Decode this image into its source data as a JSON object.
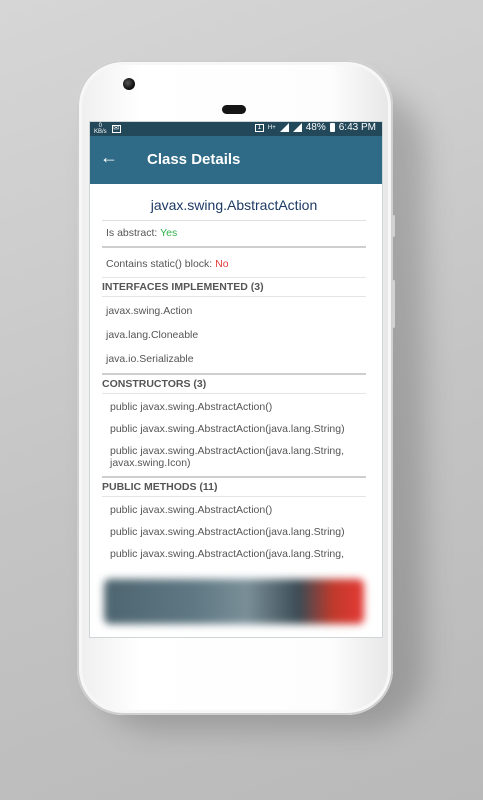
{
  "status_bar": {
    "left_top": "0",
    "left_bottom": "KB/s",
    "sim_badge": "1",
    "net_type": "H+",
    "battery": "48%",
    "time": "6:43 PM"
  },
  "app_bar": {
    "back_glyph": "←",
    "title": "Class Details"
  },
  "class_name": "javax.swing.AbstractAction",
  "props": {
    "is_abstract_label": "Is abstract: ",
    "is_abstract_value": "Yes",
    "static_block_label": "Contains static() block: ",
    "static_block_value": "No"
  },
  "interfaces": {
    "header": "INTERFACES IMPLEMENTED (3)",
    "items": [
      "javax.swing.Action",
      "java.lang.Cloneable",
      "java.io.Serializable"
    ]
  },
  "constructors": {
    "header": "CONSTRUCTORS (3)",
    "items": [
      "public javax.swing.AbstractAction()",
      "public javax.swing.AbstractAction(java.lang.String)",
      "public javax.swing.AbstractAction(java.lang.String, javax.swing.Icon)"
    ]
  },
  "methods": {
    "header": "PUBLIC METHODS (11)",
    "items": [
      "public javax.swing.AbstractAction()",
      "public javax.swing.AbstractAction(java.lang.String)",
      "public javax.swing.AbstractAction(java.lang.String,"
    ]
  },
  "colors": {
    "status_bar": "#22485a",
    "app_bar": "#2f6b86",
    "class_name": "#1e3a66",
    "yes": "#2db14a",
    "no": "#e53935"
  }
}
